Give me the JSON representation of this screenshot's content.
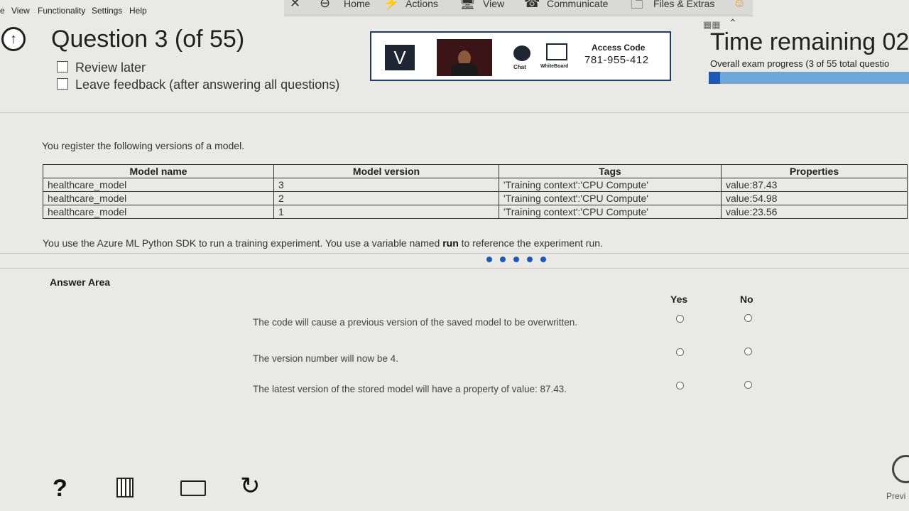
{
  "menubar": {
    "items": [
      "e",
      "View",
      "Functionality",
      "Settings",
      "Help"
    ]
  },
  "toolbar": {
    "home": "Home",
    "actions": "Actions",
    "view": "View",
    "communicate": "Communicate",
    "files": "Files & Extras"
  },
  "question": {
    "title": "Question 3 (of 55)",
    "review_later": "Review later",
    "leave_feedback": "Leave feedback (after answering all questions)"
  },
  "proctor": {
    "logo": "V",
    "chat": "Chat",
    "whiteboard": "WhiteBoard",
    "access_label": "Access Code",
    "access_code": "781-955-412"
  },
  "timer": {
    "title": "Time remaining 02",
    "progress_text": "Overall exam progress (3 of 55 total questio",
    "progress_fraction": 0.055
  },
  "content": {
    "intro": "You register the following versions of a model.",
    "table": {
      "headers": [
        "Model name",
        "Model version",
        "Tags",
        "Properties"
      ],
      "rows": [
        [
          "healthcare_model",
          "3",
          "'Training context':'CPU Compute'",
          "value:87.43"
        ],
        [
          "healthcare_model",
          "2",
          "'Training context':'CPU Compute'",
          "value:54.98"
        ],
        [
          "healthcare_model",
          "1",
          "'Training context':'CPU Compute'",
          "value:23.56"
        ]
      ]
    },
    "note_before": "You use the Azure ML Python SDK to run a training experiment. You use a variable named ",
    "note_bold": "run",
    "note_after": " to reference the experiment run."
  },
  "answer": {
    "heading": "Answer Area",
    "yes_label": "Yes",
    "no_label": "No",
    "statements": [
      "The code will cause a previous version of the saved model to be overwritten.",
      "The version number will now be 4.",
      "The latest version of the stored model will have a property of value: 87.43."
    ]
  },
  "footer": {
    "help": "?",
    "prev_label": "Previ"
  },
  "colors": {
    "accent": "#1e58b6",
    "progress_track": "#6da8d6",
    "proctor_border": "#1d3d6b"
  }
}
